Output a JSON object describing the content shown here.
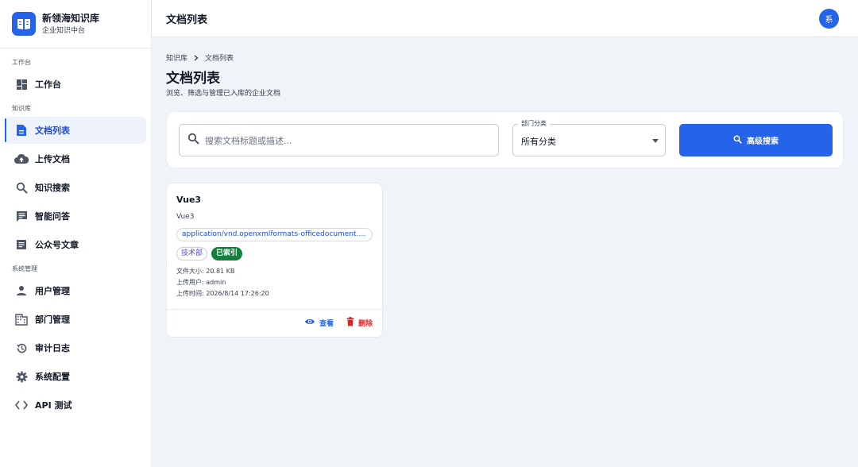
{
  "brand": {
    "title": "新领海知识库",
    "subtitle": "企业知识中台"
  },
  "sidebar": {
    "sections": [
      {
        "label": "工作台",
        "items": [
          {
            "label": "工作台",
            "icon": "dashboard-icon"
          }
        ]
      },
      {
        "label": "知识库",
        "items": [
          {
            "label": "文档列表",
            "icon": "document-icon",
            "active": true
          },
          {
            "label": "上传文档",
            "icon": "cloud-upload-icon"
          },
          {
            "label": "知识搜索",
            "icon": "search-icon"
          },
          {
            "label": "智能问答",
            "icon": "chat-icon"
          },
          {
            "label": "公众号文章",
            "icon": "article-icon"
          }
        ]
      },
      {
        "label": "系统管理",
        "items": [
          {
            "label": "用户管理",
            "icon": "user-icon"
          },
          {
            "label": "部门管理",
            "icon": "building-icon"
          },
          {
            "label": "审计日志",
            "icon": "history-icon"
          },
          {
            "label": "系统配置",
            "icon": "gear-icon"
          },
          {
            "label": "API 测试",
            "icon": "code-icon"
          }
        ]
      }
    ]
  },
  "header": {
    "title": "文档列表",
    "avatar": "系"
  },
  "breadcrumb": {
    "root": "知识库",
    "current": "文档列表"
  },
  "page": {
    "title": "文档列表",
    "subtitle": "浏览、筛选与管理已入库的企业文档"
  },
  "filters": {
    "search_placeholder": "搜索文档标题或描述...",
    "category_label": "部门分类",
    "category_value": "所有分类",
    "advanced_button": "高级搜索"
  },
  "documents": [
    {
      "title": "Vue3",
      "description": "Vue3",
      "mime_type": "application/vnd.openxmlformats-officedocument.wordprocessingml.document",
      "department": "技术部",
      "status": "已索引",
      "size_label": "文件大小: 20.81 KB",
      "uploader_label": "上传用户: admin",
      "time_label": "上传时间: 2026/8/14 17:26:20",
      "view_label": "查看",
      "delete_label": "删除"
    }
  ],
  "colors": {
    "primary": "#2563eb",
    "success": "#15803d",
    "danger": "#dc2626",
    "background": "#f0f3f8"
  }
}
